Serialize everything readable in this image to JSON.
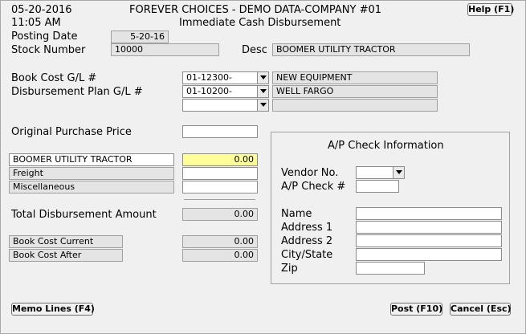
{
  "header": {
    "date": "05-20-2016",
    "time": "11:05 AM",
    "company": "FOREVER CHOICES - DEMO DATA-COMPANY #01",
    "screen_title": "Immediate Cash Disbursement",
    "help_label": "Help (F1)"
  },
  "posting_date": {
    "label": "Posting Date",
    "value": "5-20-16"
  },
  "stock_number": {
    "label": "Stock Number",
    "value": "10000"
  },
  "desc": {
    "label": "Desc",
    "value": "BOOMER UTILITY TRACTOR"
  },
  "gl": {
    "book_cost_label": "Book Cost G/L #",
    "book_cost_account": "01-12300-",
    "book_cost_desc": "NEW EQUIPMENT",
    "disbursement_label": "Disbursement Plan G/L #",
    "disbursement_account": "01-10200-",
    "disbursement_desc": "WELL FARGO",
    "extra_account": "",
    "extra_desc": ""
  },
  "original_purchase_price": {
    "label": "Original Purchase Price",
    "value": ""
  },
  "lines": {
    "item_label": "BOOMER UTILITY TRACTOR",
    "item_value": "0.00",
    "freight_label": "Freight",
    "freight_value": "",
    "misc_label": "Miscellaneous",
    "misc_value": ""
  },
  "total": {
    "label": "Total Disbursement Amount",
    "value": "0.00"
  },
  "book_cost": {
    "current_label": "Book Cost Current",
    "current_value": "0.00",
    "after_label": "Book Cost After",
    "after_value": "0.00"
  },
  "ap_check": {
    "title": "A/P Check Information",
    "vendor_label": "Vendor No.",
    "vendor_value": "",
    "check_label": "A/P Check #",
    "check_value": "",
    "name_label": "Name",
    "name_value": "",
    "address1_label": "Address 1",
    "address1_value": "",
    "address2_label": "Address 2",
    "address2_value": "",
    "city_label": "City/State",
    "city_value": "",
    "zip_label": "Zip",
    "zip_value": ""
  },
  "buttons": {
    "memo": "Memo Lines (F4)",
    "post": "Post (F10)",
    "cancel": "Cancel (Esc)"
  },
  "colors": {
    "highlight": "#ffff99",
    "readonly": "#e4e4e4",
    "background": "#f0f0f0"
  },
  "icons": {
    "dropdown": "chevron-down-icon"
  }
}
